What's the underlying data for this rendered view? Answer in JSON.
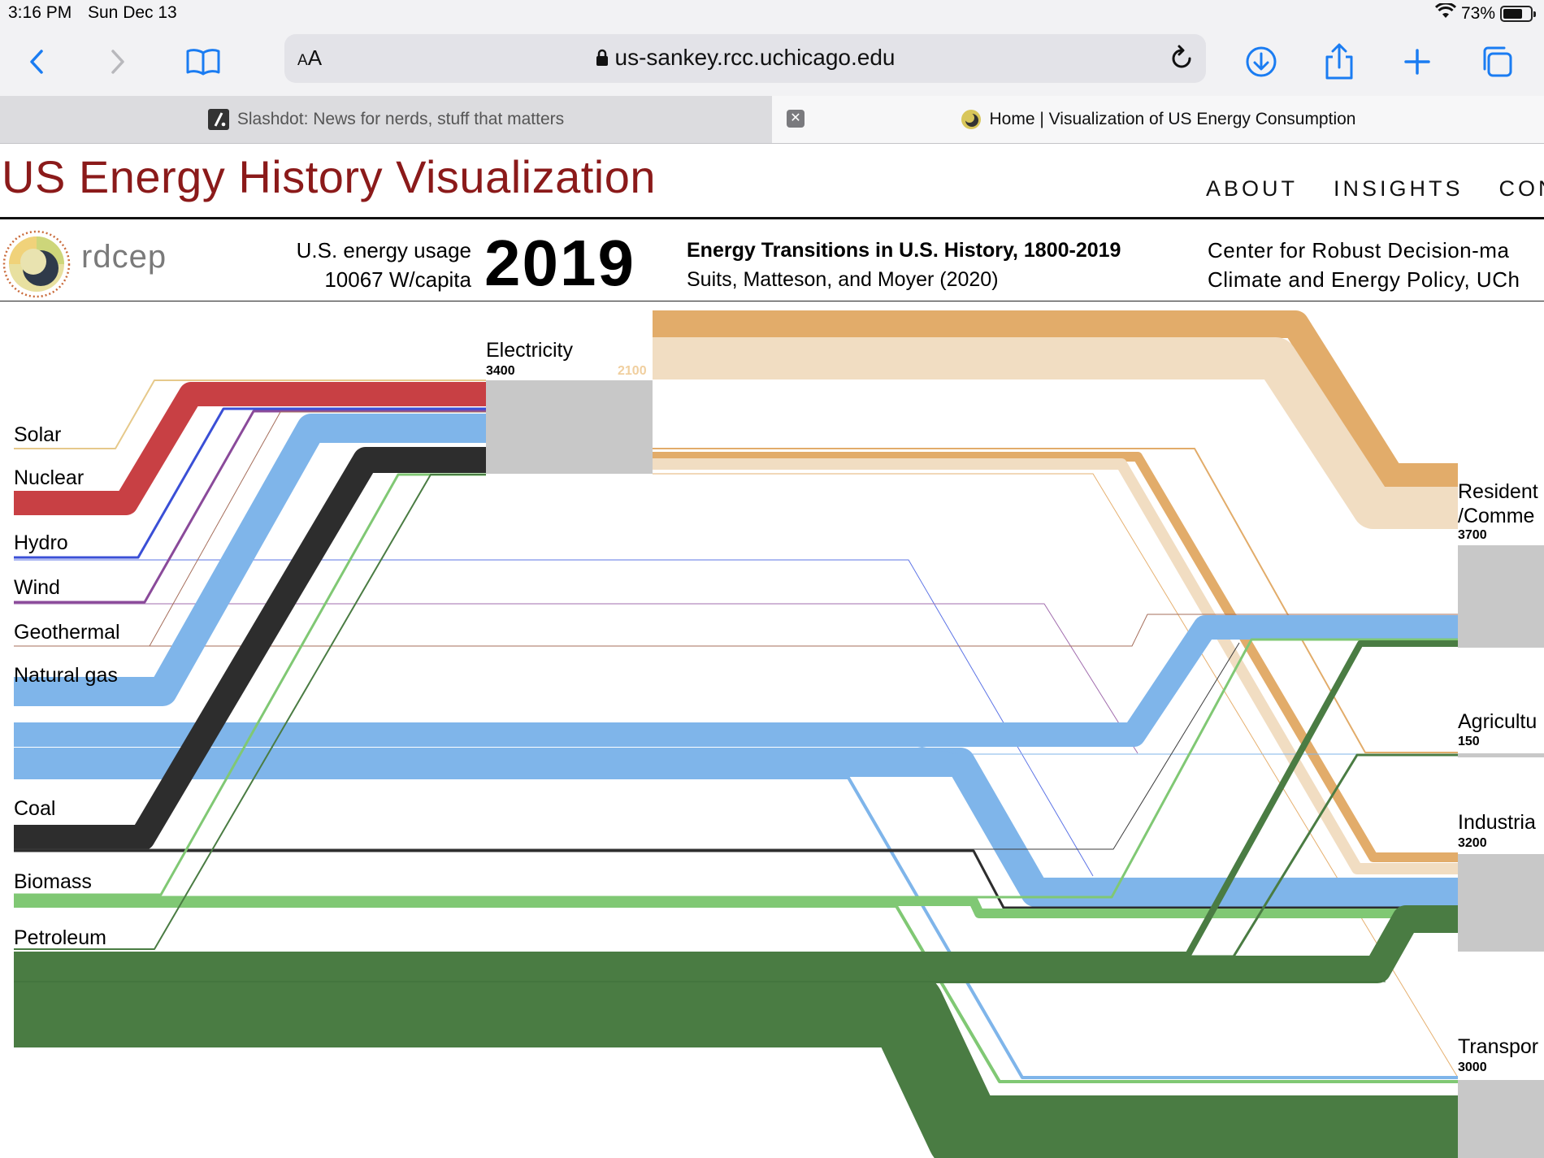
{
  "status_bar": {
    "time": "3:16 PM",
    "date": "Sun Dec 13",
    "battery": "73%",
    "battery_level": 0.73
  },
  "browser": {
    "text_size_label": "AA",
    "url": "us-sankey.rcc.uchicago.edu",
    "tabs": [
      {
        "title": "Slashdot: News for nerds, stuff that matters",
        "active": false
      },
      {
        "title": "Home | Visualization of US Energy Consumption",
        "active": true
      }
    ],
    "icons": [
      "back-icon",
      "forward-icon",
      "bookmarks-icon",
      "lock-icon",
      "reload-icon",
      "download-icon",
      "share-icon",
      "new-tab-icon",
      "tabs-icon",
      "close-icon"
    ]
  },
  "site": {
    "title": "US Energy History Visualization",
    "nav": [
      "ABOUT",
      "INSIGHTS",
      "CON"
    ],
    "logo_text": "rdcep",
    "usage_label": "U.S. energy usage",
    "usage_value": "10067 W/capita",
    "year": "2019",
    "paper_title": "Energy Transitions in U.S. History, 1800-2019",
    "paper_authors": "Suits, Matteson, and Moyer (2020)",
    "center_line1": "Center for Robust Decision-ma",
    "center_line2": "Climate and Energy Policy, UCh"
  },
  "colors": {
    "solar": "#e6c98b",
    "nuclear": "#c84044",
    "hydro": "#3a4fd6",
    "wind": "#8a4a9a",
    "geothermal": "#a56d5a",
    "natural_gas": "#7fb5ea",
    "coal": "#2d2d2d",
    "biomass": "#80c874",
    "petroleum": "#4a7c43",
    "electricity_out": "#e2ac6a",
    "electricity_loss": "#f1ddc2",
    "node": "#c8c8c8",
    "title": "#8b1a1a"
  },
  "chart_data": {
    "type": "sankey",
    "sources": [
      "Solar",
      "Nuclear",
      "Hydro",
      "Wind",
      "Geothermal",
      "Natural gas",
      "Coal",
      "Biomass",
      "Petroleum"
    ],
    "electricity": {
      "label": "Electricity",
      "value": "3400",
      "secondary_value": "2100"
    },
    "sinks": [
      {
        "label": "Resident",
        "label2": "/Comme",
        "value": "3700"
      },
      {
        "label": "Agricultu",
        "value": "150"
      },
      {
        "label": "Industria",
        "value": "3200"
      },
      {
        "label": "Transpor",
        "value": "3000"
      }
    ]
  }
}
